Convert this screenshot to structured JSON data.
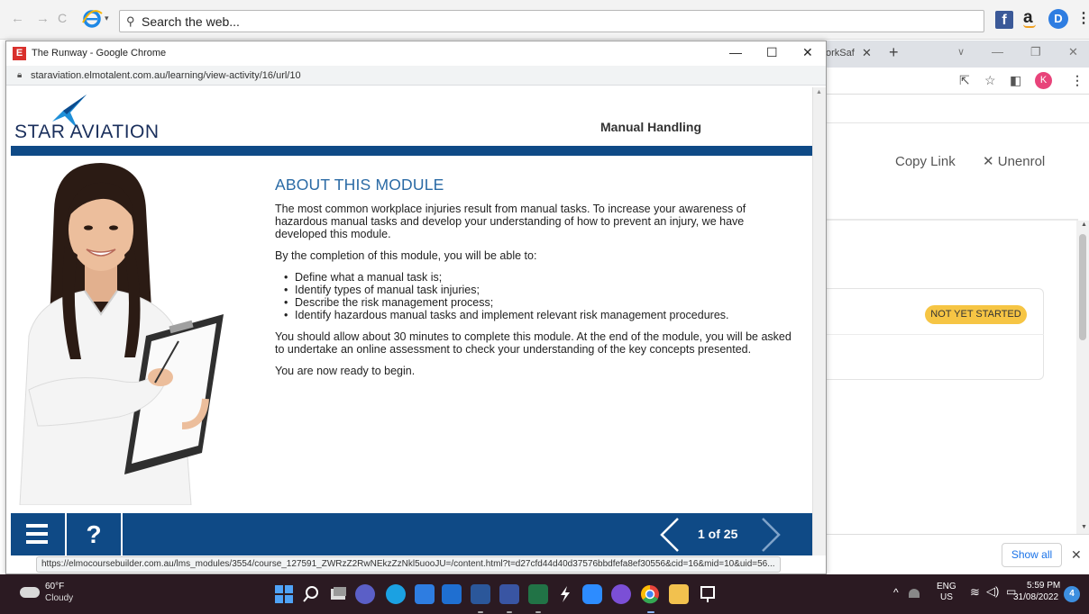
{
  "top_bar": {
    "search_placeholder": "Search the web...",
    "back_icon": "←",
    "forward_icon": "→",
    "refresh_icon": "C"
  },
  "background_window": {
    "tab_partial_label": "orkSaf",
    "copy_link_label": "Copy Link",
    "unenrol_label": "✕ Unenrol",
    "status_badge": "NOT YET STARTED",
    "status_badge_color": "#f6c544",
    "show_all_label": "Show all",
    "avatar_letter": "K"
  },
  "popup": {
    "title": "The Runway - Google Chrome",
    "url": "staraviation.elmotalent.com.au/learning/view-activity/16/url/10",
    "status_url": "https://elmocoursebuilder.com.au/lms_modules/3554/course_127591_ZWRzZ2RwNEkzZzNkl5uooJU=/content.html?t=d27cfd44d40d37576bbdfefa8ef30556&cid=16&mid=10&uid=56..."
  },
  "course": {
    "logo_text": "STAR AVIATION",
    "module_name": "Manual Handling",
    "heading": "ABOUT THIS MODULE",
    "intro": "The most common workplace injuries result from manual tasks. To increase your awareness of hazardous manual tasks and develop your understanding of how to prevent an injury, we have developed this module.",
    "objectives_intro": "By the completion of this module, you will be able to:",
    "objectives": [
      "Define what a manual task is;",
      "Identify types of manual task injuries;",
      "Describe the risk management process;",
      "Identify hazardous manual tasks and implement relevant risk management procedures."
    ],
    "duration_text": "You should allow about 30 minutes to complete this module. At the end of the module, you will be asked to undertake an online assessment to check your understanding of the key concepts presented.",
    "ready_text": "You are now ready to begin.",
    "page_counter": "1 of 25",
    "help_label": "?",
    "accent_color": "#0f4a86",
    "heading_color": "#2a6aa5"
  },
  "taskbar": {
    "weather_temp": "60°F",
    "weather_desc": "Cloudy",
    "lang_line1": "ENG",
    "lang_line2": "US",
    "time": "5:59 PM",
    "date": "31/08/2022",
    "notification_count": "4"
  }
}
